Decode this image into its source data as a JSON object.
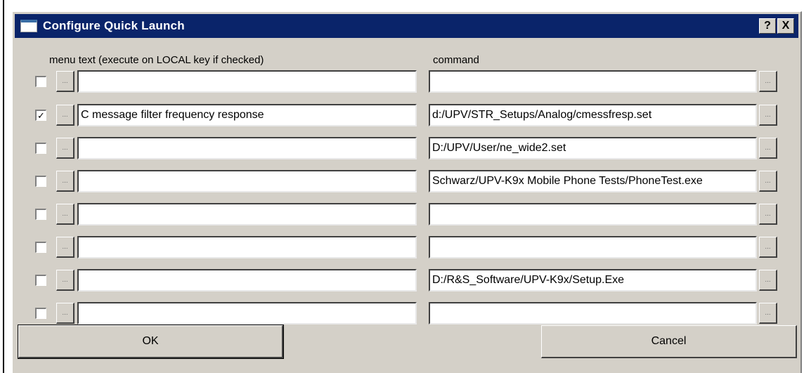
{
  "title": "Configure Quick Launch",
  "titlebar_buttons": {
    "help": "?",
    "close": "X"
  },
  "columns": {
    "menu_label": "menu text (execute on LOCAL key if checked)",
    "command_label": "command"
  },
  "browse_label": "...",
  "rows": [
    {
      "checked": false,
      "menu_text": "",
      "command": ""
    },
    {
      "checked": true,
      "menu_text": "C message filter frequency response",
      "command": "d:/UPV/STR_Setups/Analog/cmessfresp.set"
    },
    {
      "checked": false,
      "menu_text": "",
      "command": "D:/UPV/User/ne_wide2.set"
    },
    {
      "checked": false,
      "menu_text": "",
      "command": "Schwarz/UPV-K9x Mobile Phone Tests/PhoneTest.exe"
    },
    {
      "checked": false,
      "menu_text": "",
      "command": ""
    },
    {
      "checked": false,
      "menu_text": "",
      "command": ""
    },
    {
      "checked": false,
      "menu_text": "",
      "command": "D:/R&S_Software/UPV-K9x/Setup.Exe"
    },
    {
      "checked": false,
      "menu_text": "",
      "command": ""
    }
  ],
  "buttons": {
    "ok": "OK",
    "cancel": "Cancel"
  }
}
